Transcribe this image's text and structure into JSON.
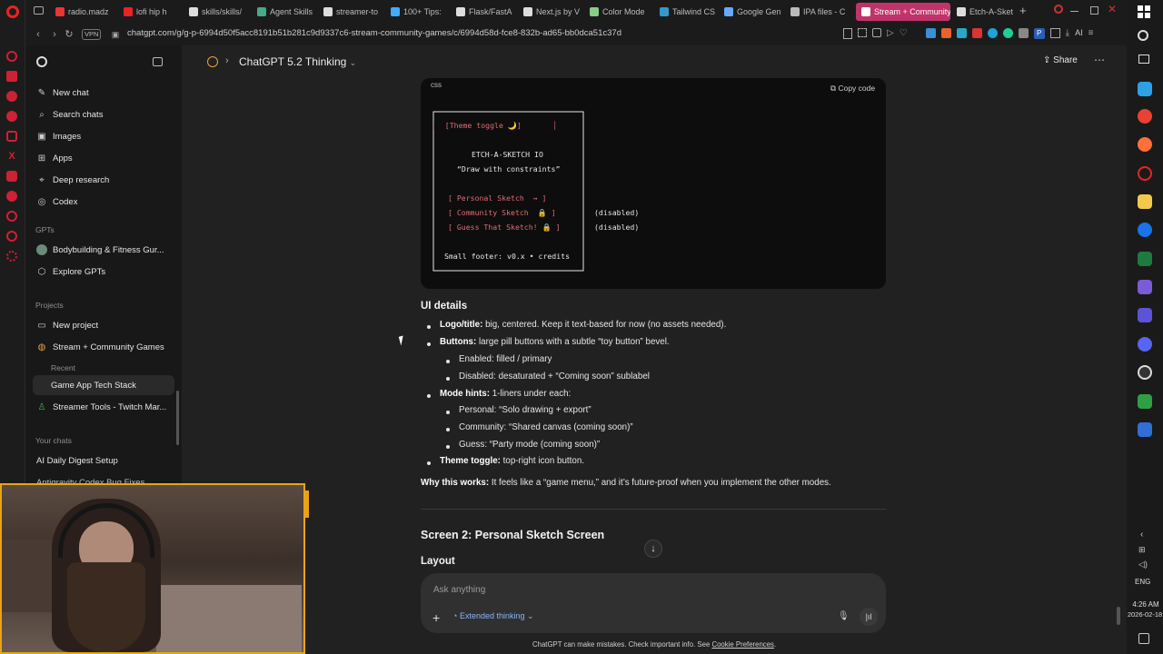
{
  "browser": {
    "tabs": [
      {
        "label": "radio.madz",
        "color": "#e33"
      },
      {
        "label": "lofi hip h",
        "color": "#e22"
      },
      {
        "label": "skills/skills/",
        "color": "#ddd"
      },
      {
        "label": "Agent Skills",
        "color": "#4a8"
      },
      {
        "label": "streamer-to",
        "color": "#ddd"
      },
      {
        "label": "100+ Tips:",
        "color": "#4af"
      },
      {
        "label": "Flask/FastA",
        "color": "#ddd"
      },
      {
        "label": "Next.js by V",
        "color": "#ddd"
      },
      {
        "label": "Color Mode",
        "color": "#8c8"
      },
      {
        "label": "Tailwind CS",
        "color": "#39c"
      },
      {
        "label": "Google Gen",
        "color": "#6af"
      },
      {
        "label": "IPA files - C",
        "color": "#bbb"
      },
      {
        "label": "Stream + Community",
        "color": "#fff",
        "active": true
      },
      {
        "label": "Etch-A-Sket",
        "color": "#ddd"
      }
    ],
    "vpn_label": "VPN",
    "url": "chatgpt.com/g/g-p-6994d50f5acc8191b51b281c9d9337c6-stream-community-games/c/6994d58d-fce8-832b-ad65-bb0dca51c37d",
    "ai_label": "AI"
  },
  "sidebar": {
    "items": [
      {
        "label": "New chat",
        "icon": "edit-icon"
      },
      {
        "label": "Search chats",
        "icon": "search-icon"
      },
      {
        "label": "Images",
        "icon": "image-icon"
      },
      {
        "label": "Apps",
        "icon": "apps-icon"
      },
      {
        "label": "Deep research",
        "icon": "telescope-icon"
      },
      {
        "label": "Codex",
        "icon": "codex-icon"
      }
    ],
    "gpts_header": "GPTs",
    "gpts": [
      {
        "label": "Bodybuilding & Fitness Gur..."
      },
      {
        "label": "Explore GPTs"
      }
    ],
    "projects_header": "Projects",
    "projects": [
      {
        "label": "New project"
      },
      {
        "label": "Stream + Community Games"
      }
    ],
    "recent_header": "Recent",
    "recent": [
      {
        "label": "Game App Tech Stack"
      }
    ],
    "other_projects": [
      {
        "label": "Streamer Tools - Twitch Mar..."
      }
    ],
    "chats_header": "Your chats",
    "chats": [
      {
        "label": "AI Daily Digest Setup"
      },
      {
        "label": "Antigravity Codex Bug Fixes"
      }
    ]
  },
  "header": {
    "model": "ChatGPT 5.2 Thinking",
    "share": "Share"
  },
  "code": {
    "lang": "css",
    "copy": "Copy code",
    "lines": [
      "┌─────────────────────────┐",
      "│  [Theme toggle 🌙]       │",
      "│                         │",
      "│      ETCH-A-SKETCH IO   │",
      "│    \"Draw with constraints\" │",
      "│                         │",
      "│   [ Personal Sketch  → ]  │",
      "│   [ Community Sketch  🔒 ]  │   (disabled)",
      "│   [ Guess That Sketch! 🔒 ] │   (disabled)",
      "│                         │",
      "│ Small footer: v0.x • credits │",
      "└─────────────────────────┘"
    ]
  },
  "content": {
    "ui_details_heading": "UI details",
    "items": [
      {
        "bold": "Logo/title:",
        "text": " big, centered. Keep it text-based for now (no assets needed).",
        "level": 1
      },
      {
        "bold": "Buttons:",
        "text": " large pill buttons with a subtle “toy button” bevel.",
        "level": 1
      },
      {
        "bold": "",
        "text": "Enabled: filled / primary",
        "level": 2
      },
      {
        "bold": "",
        "text": "Disabled: desaturated + “Coming soon” sublabel",
        "level": 2
      },
      {
        "bold": "Mode hints:",
        "text": " 1-liners under each:",
        "level": 1
      },
      {
        "bold": "",
        "text": "Personal: “Solo drawing + export”",
        "level": 2
      },
      {
        "bold": "",
        "text": "Community: “Shared canvas (coming soon)”",
        "level": 2
      },
      {
        "bold": "",
        "text": "Guess: “Party mode (coming soon)”",
        "level": 2
      },
      {
        "bold": "Theme toggle:",
        "text": " top-right icon button.",
        "level": 1
      }
    ],
    "why_bold": "Why this works:",
    "why_text": " It feels like a “game menu,” and it’s future-proof when you implement the other modes.",
    "screen2_heading": "Screen 2: Personal Sketch Screen",
    "layout_heading": "Layout"
  },
  "composer": {
    "placeholder": "Ask anything",
    "thinking": "Extended thinking"
  },
  "footer": {
    "disclaimer": "ChatGPT can make mistakes. Check important info. See ",
    "link": "Cookie Preferences",
    "end": "."
  },
  "taskbar": {
    "lang": "ENG",
    "time": "4:26 AM",
    "date": "2026-02-18"
  }
}
